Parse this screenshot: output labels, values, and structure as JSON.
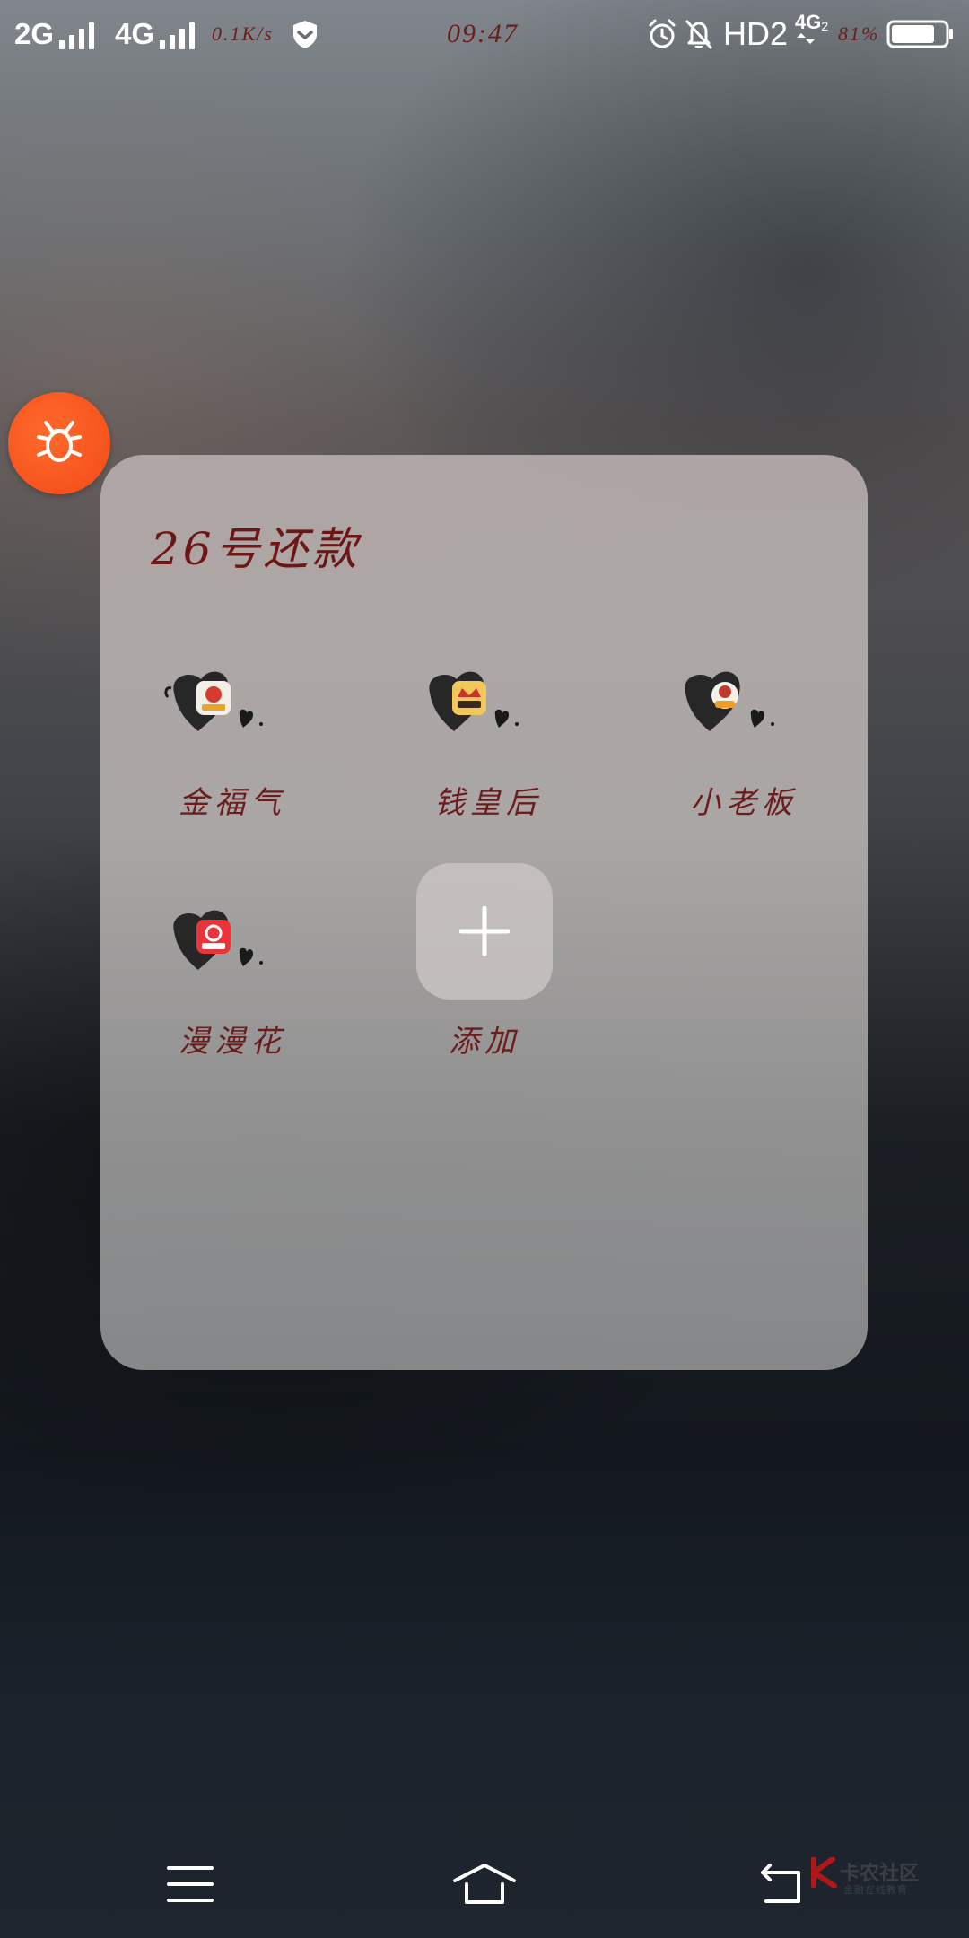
{
  "status_bar": {
    "network1": "2G",
    "network2": "4G",
    "speed": "0.1K/s",
    "time": "09:47",
    "hd": "HD2",
    "net_type": "4G",
    "net_sub": "2",
    "battery": "81%",
    "battery_level": 0.81
  },
  "folder": {
    "title": "26号还款",
    "apps": [
      {
        "label": "金福气",
        "icon": "jinfuqi-app-icon"
      },
      {
        "label": "钱皇后",
        "icon": "qianhuanghou-app-icon"
      },
      {
        "label": "小老板",
        "icon": "xiaolaoban-app-icon"
      },
      {
        "label": "漫漫花",
        "icon": "manmanhua-app-icon"
      }
    ],
    "add_label": "添加"
  },
  "floating_button": {
    "icon": "bug-icon"
  },
  "nav": {
    "menu_icon": "menu-icon",
    "home_icon": "home-icon",
    "back_icon": "back-icon"
  },
  "watermark": {
    "text": "卡农社区",
    "subtext": "金融在线教育"
  },
  "colors": {
    "accent_text": "#6b1d1d",
    "bug_button": "#f24a19"
  }
}
